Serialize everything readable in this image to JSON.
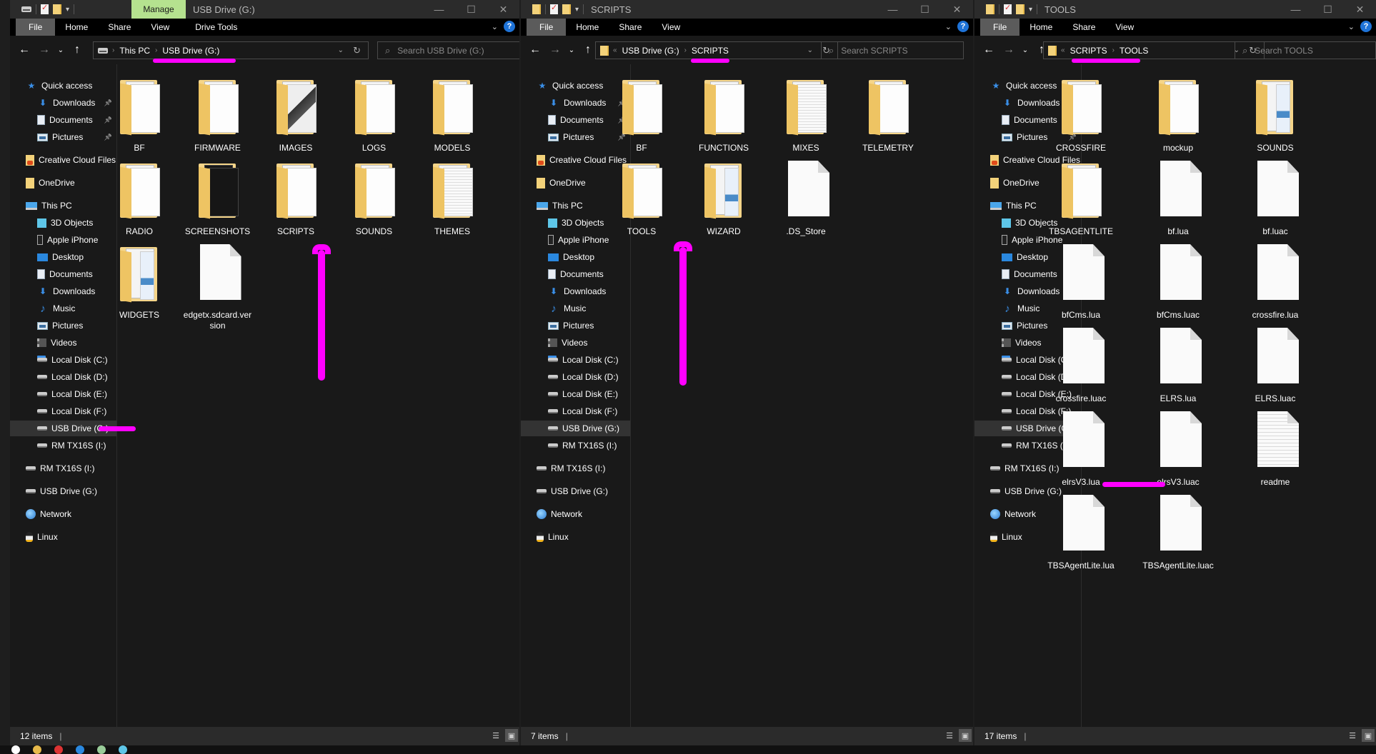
{
  "windows": [
    {
      "title": "USB Drive (G:)",
      "contextual_tab": "Manage",
      "ribbon_tabs": [
        "File",
        "Home",
        "Share",
        "View",
        "Drive Tools"
      ],
      "address": [
        "This PC",
        "USB Drive (G:)"
      ],
      "address_icon": "drive-icon",
      "address_prefix": "",
      "search_placeholder": "Search USB Drive (G:)",
      "status": "12 items",
      "selected_nav": "USB Drive (G:)",
      "items": [
        {
          "name": "BF",
          "type": "folder"
        },
        {
          "name": "FIRMWARE",
          "type": "folder"
        },
        {
          "name": "IMAGES",
          "type": "folder"
        },
        {
          "name": "LOGS",
          "type": "folder"
        },
        {
          "name": "MODELS",
          "type": "folder"
        },
        {
          "name": "RADIO",
          "type": "folder"
        },
        {
          "name": "SCREENSHOTS",
          "type": "folder"
        },
        {
          "name": "SCRIPTS",
          "type": "folder"
        },
        {
          "name": "SOUNDS",
          "type": "folder"
        },
        {
          "name": "THEMES",
          "type": "folder"
        },
        {
          "name": "WIDGETS",
          "type": "folder"
        },
        {
          "name": "edgetx.sdcard.version",
          "type": "file"
        }
      ]
    },
    {
      "title": "SCRIPTS",
      "contextual_tab": "",
      "ribbon_tabs": [
        "File",
        "Home",
        "Share",
        "View"
      ],
      "address": [
        "USB Drive (G:)",
        "SCRIPTS"
      ],
      "address_icon": "folder-icon",
      "address_prefix": "«",
      "search_placeholder": "Search SCRIPTS",
      "status": "7 items",
      "selected_nav": "USB Drive (G:)",
      "items": [
        {
          "name": "BF",
          "type": "folder"
        },
        {
          "name": "FUNCTIONS",
          "type": "folder"
        },
        {
          "name": "MIXES",
          "type": "folder"
        },
        {
          "name": "TELEMETRY",
          "type": "folder"
        },
        {
          "name": "TOOLS",
          "type": "folder"
        },
        {
          "name": "WIZARD",
          "type": "folder"
        },
        {
          "name": ".DS_Store",
          "type": "file"
        }
      ]
    },
    {
      "title": "TOOLS",
      "contextual_tab": "",
      "ribbon_tabs": [
        "File",
        "Home",
        "Share",
        "View"
      ],
      "address": [
        "SCRIPTS",
        "TOOLS"
      ],
      "address_icon": "folder-icon",
      "address_prefix": "«",
      "search_placeholder": "Search TOOLS",
      "status": "17 items",
      "selected_nav": "USB Drive (G:)",
      "items": [
        {
          "name": "CROSSFIRE",
          "type": "folder"
        },
        {
          "name": "mockup",
          "type": "folder"
        },
        {
          "name": "SOUNDS",
          "type": "folder"
        },
        {
          "name": "TBSAGENTLITE",
          "type": "folder"
        },
        {
          "name": "bf.lua",
          "type": "file"
        },
        {
          "name": "bf.luac",
          "type": "file"
        },
        {
          "name": "bfCms.lua",
          "type": "file"
        },
        {
          "name": "bfCms.luac",
          "type": "file"
        },
        {
          "name": "crossfire.lua",
          "type": "file"
        },
        {
          "name": "crossfire.luac",
          "type": "file"
        },
        {
          "name": "ELRS.lua",
          "type": "file"
        },
        {
          "name": "ELRS.luac",
          "type": "file"
        },
        {
          "name": "elrsV3.lua",
          "type": "file"
        },
        {
          "name": "elrsV3.luac",
          "type": "file"
        },
        {
          "name": "readme",
          "type": "textfile"
        },
        {
          "name": "TBSAgentLite.lua",
          "type": "file"
        },
        {
          "name": "TBSAgentLite.luac",
          "type": "file"
        }
      ]
    }
  ],
  "nav_pane": [
    {
      "label": "Quick access",
      "icon": "star-icon",
      "level": 0
    },
    {
      "label": "Downloads",
      "icon": "download-icon",
      "level": 1,
      "pinned": true
    },
    {
      "label": "Documents",
      "icon": "document-icon",
      "level": 1,
      "pinned": true
    },
    {
      "label": "Pictures",
      "icon": "pictures-icon",
      "level": 1,
      "pinned": true
    },
    {
      "label": "Creative Cloud Files",
      "icon": "creative-cloud-icon",
      "level": 0
    },
    {
      "label": "OneDrive",
      "icon": "onedrive-icon",
      "level": 0
    },
    {
      "label": "This PC",
      "icon": "computer-icon",
      "level": 0
    },
    {
      "label": "3D Objects",
      "icon": "3d-objects-icon",
      "level": 1
    },
    {
      "label": "Apple iPhone",
      "icon": "phone-icon",
      "level": 1
    },
    {
      "label": "Desktop",
      "icon": "desktop-icon",
      "level": 1
    },
    {
      "label": "Documents",
      "icon": "document-icon",
      "level": 1
    },
    {
      "label": "Downloads",
      "icon": "download-icon",
      "level": 1
    },
    {
      "label": "Music",
      "icon": "music-icon",
      "level": 1
    },
    {
      "label": "Pictures",
      "icon": "pictures-icon",
      "level": 1
    },
    {
      "label": "Videos",
      "icon": "videos-icon",
      "level": 1
    },
    {
      "label": "Local Disk (C:)",
      "icon": "system-drive-icon",
      "level": 1
    },
    {
      "label": "Local Disk (D:)",
      "icon": "drive-icon",
      "level": 1
    },
    {
      "label": "Local Disk (E:)",
      "icon": "drive-icon",
      "level": 1
    },
    {
      "label": "Local Disk (F:)",
      "icon": "drive-icon",
      "level": 1
    },
    {
      "label": "USB Drive (G:)",
      "icon": "drive-icon",
      "level": 1
    },
    {
      "label": "RM TX16S (I:)",
      "icon": "drive-icon",
      "level": 1
    },
    {
      "label": "RM TX16S (I:)",
      "icon": "drive-icon",
      "level": 0
    },
    {
      "label": "USB Drive (G:)",
      "icon": "drive-icon",
      "level": 0
    },
    {
      "label": "Network",
      "icon": "network-icon",
      "level": 0
    },
    {
      "label": "Linux",
      "icon": "linux-icon",
      "level": 0
    }
  ],
  "window_controls": {
    "minimize": "—",
    "maximize": "☐",
    "close": "✕"
  },
  "annotation_color": "#ff00ff",
  "colors": {
    "manage_tab": "#b5e28f",
    "file_tab": "#5b5b5b",
    "selection": "#333333",
    "accent": "#1e73d8"
  }
}
